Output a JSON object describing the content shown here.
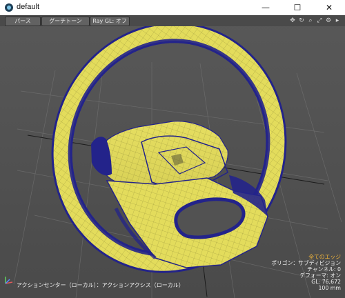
{
  "window": {
    "title": "default",
    "buttons": {
      "minimize": "—",
      "maximize": "☐",
      "close": "✕"
    }
  },
  "toolbar": {
    "perspective": "パース",
    "shading": "グーチトーン",
    "raygl": "Ray GL: オフ",
    "icons": [
      "move-icon",
      "rotate-icon",
      "search-icon",
      "fit-icon",
      "gear-icon",
      "arrow-right-icon"
    ]
  },
  "status": {
    "action_center": "アクションセンター（ローカル）：アクションアクシス（ローカル）"
  },
  "info": {
    "edges": "全てのエッジ",
    "polygon": "ポリゴン：サブディビジョン",
    "channel": "チャンネル: 0",
    "deformer": "デフォーマ: オン",
    "gl": "GL: 76,672",
    "size": "100 mm"
  },
  "colors": {
    "model": "#e3dc5c",
    "model_shadow": "#23238a",
    "grid": "#7a7a7a",
    "highlight": "#f0b43a"
  }
}
